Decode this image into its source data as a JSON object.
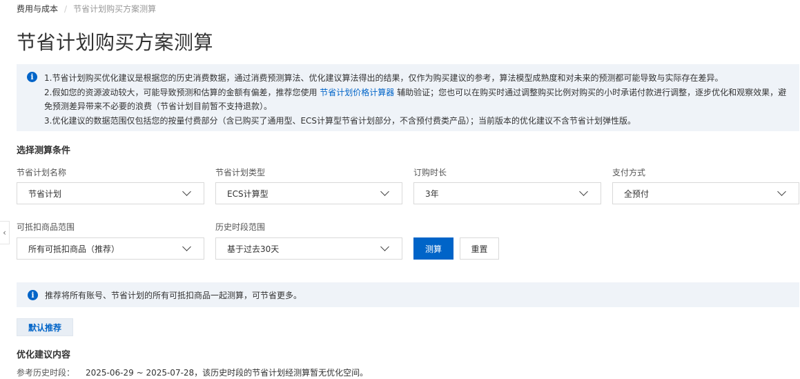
{
  "breadcrumb": {
    "root": "费用与成本",
    "separator": "/",
    "current": "节省计划购买方案测算"
  },
  "page_title": "节省计划购买方案测算",
  "notice": {
    "line1": "1.节省计划购买优化建议是根据您的历史消费数据，通过消费预测算法、优化建议算法得出的结果，仅作为购买建议的参考，算法模型成熟度和对未来的预测都可能导致与实际存在差异。",
    "line2_before": "2.假如您的资源波动较大，可能导致预测和估算的金额有偏差，推荐您使用 ",
    "line2_link": "节省计划价格计算器",
    "line2_after": " 辅助验证；您也可以在购买时通过调整购买比例对购买的小时承诺付款进行调整，逐步优化和观察效果，避免预测差异带来不必要的浪费（节省计划目前暂不支持退款）。",
    "line3": "3.优化建议的数据范围仅包括您的按量付费部分（含已购买了通用型、ECS计算型节省计划部分，不含预付费类产品）；当前版本的优化建议不含节省计划弹性版。"
  },
  "conditions": {
    "title": "选择测算条件",
    "fields": {
      "plan_name": {
        "label": "节省计划名称",
        "value": "节省计划"
      },
      "plan_type": {
        "label": "节省计划类型",
        "value": "ECS计算型"
      },
      "duration": {
        "label": "订购时长",
        "value": "3年"
      },
      "payment": {
        "label": "支付方式",
        "value": "全预付"
      },
      "scope": {
        "label": "可抵扣商品范围",
        "value": "所有可抵扣商品（推荐）"
      },
      "history_range": {
        "label": "历史时段范围",
        "value": "基于过去30天"
      }
    },
    "calc_button": "测算",
    "reset_button": "重置"
  },
  "recommend_notice": "推荐将所有账号、节省计划的所有可抵扣商品一起测算，可节省更多。",
  "default_recommend_button": "默认推荐",
  "result": {
    "title": "优化建议内容",
    "history_label": "参考历史时段：",
    "history_value": "2025-06-29  ~  2025-07-28，该历史时段的节省计划经测算暂无优化空间。"
  },
  "icons": {
    "info": "info-icon",
    "chevron": "chevron-down-icon",
    "collapse": "chevron-left-icon"
  },
  "colors": {
    "primary": "#0064c8",
    "notice_bg": "#eff3f8"
  }
}
